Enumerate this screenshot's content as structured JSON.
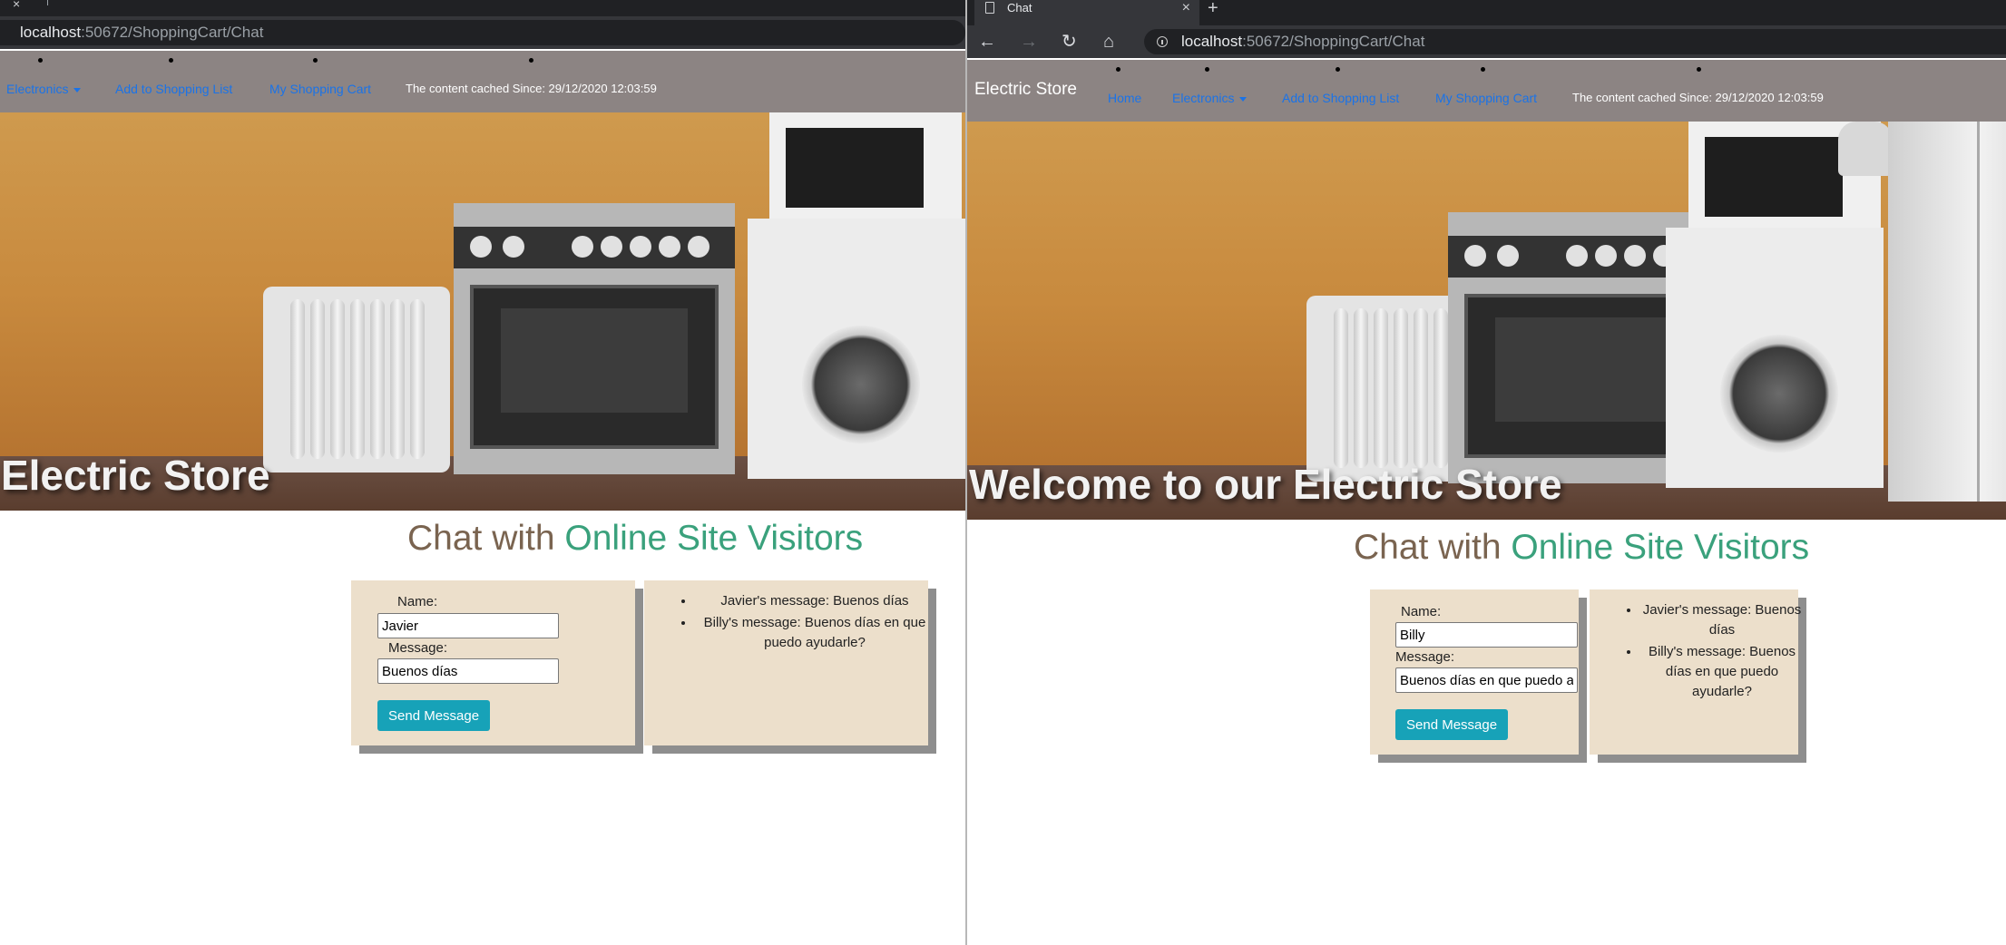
{
  "browser": {
    "tab_title": "Chat",
    "new_tab": "+",
    "tab_close": "×",
    "url_host": "localhost",
    "url_rest": ":50672/ShoppingCart/Chat",
    "back": "←",
    "forward": "→",
    "reload": "↻",
    "home": "⌂"
  },
  "site": {
    "brand": "Electric Store",
    "nav": {
      "home": "Home",
      "electronics": "Electronics",
      "add_to_list": "Add to Shopping List",
      "my_cart": "My Shopping Cart",
      "cached": "The content cached Since: 29/12/2020 12:03:59"
    },
    "hero_title": "Welcome to our Electric Store"
  },
  "chat": {
    "heading_prefix": "Chat with ",
    "heading_accent": "Online Site Visitors",
    "name_label": "Name:",
    "message_label": "Message:",
    "send_label": "Send Message",
    "messages": [
      "Javier's message: Buenos días",
      "Billy's message: Buenos días en que puedo ayudarle?"
    ]
  },
  "left_window": {
    "name_value": "Javier",
    "message_value": "Buenos días"
  },
  "right_window": {
    "name_value": "Billy",
    "message_value": "Buenos días en que puedo a"
  },
  "colors": {
    "navbar": "#8c8483",
    "link": "#1a73e8",
    "accent_green": "#3aa17c",
    "heading_brown": "#7a6450",
    "card": "#ecdfcb",
    "button": "#17a2b8"
  }
}
